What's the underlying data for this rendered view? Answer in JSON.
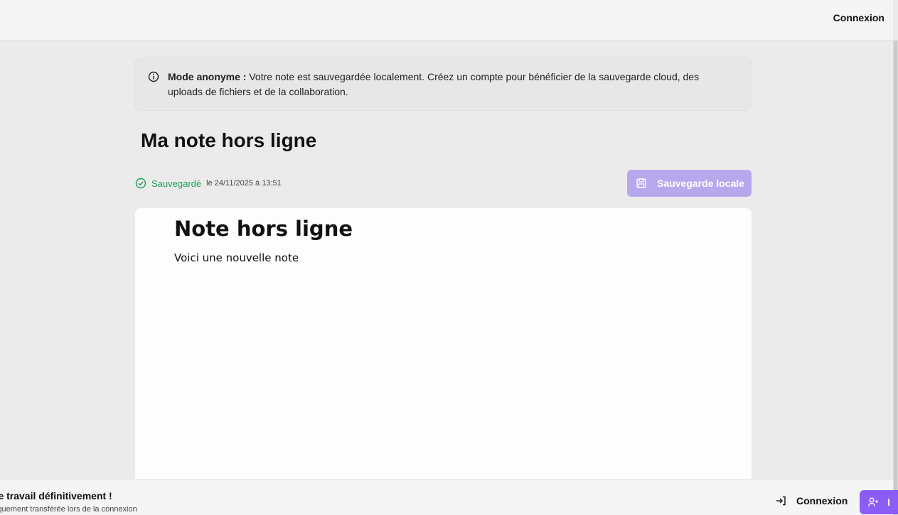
{
  "header": {
    "login_label": "Connexion"
  },
  "banner": {
    "label": "Mode anonyme :",
    "text": " Votre note est sauvegardée localement. Créez un compte pour bénéficier de la sauvegarde cloud, des uploads de fichiers et de la collaboration.",
    "icon": "info-icon"
  },
  "note": {
    "title": "Ma note hors ligne",
    "status_label": "Sauvegardé",
    "status_date": "le 24/11/2025 à 13:51",
    "save_button_label": "Sauvegarde locale",
    "content_heading": "Note hors ligne",
    "content_paragraph": "Voici une nouvelle note"
  },
  "bottom_bar": {
    "warning_title": "re travail définitivement !",
    "warning_subtitle": "iquement transférée lors de la connexion",
    "login_label": "Connexion",
    "signup_label": "I"
  },
  "colors": {
    "accent": "#8b5cf6",
    "accent_disabled": "#b7a8ee",
    "success": "#1f9d5b"
  }
}
